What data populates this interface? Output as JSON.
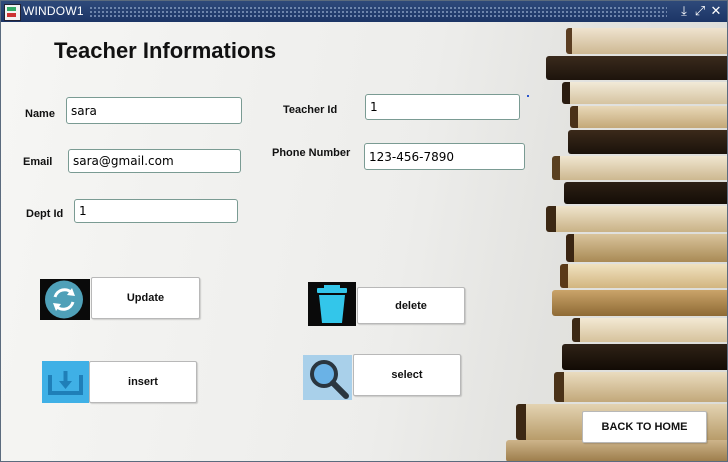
{
  "window": {
    "title": "WINDOW1",
    "controls": {
      "minimize": "⤓",
      "restore": "⤢",
      "close": "✕"
    }
  },
  "form": {
    "heading": "Teacher Informations",
    "fields": {
      "name": {
        "label": "Name",
        "value": "sara"
      },
      "email": {
        "label": "Email",
        "value": "sara@gmail.com"
      },
      "dept_id": {
        "label": "Dept Id",
        "value": "1"
      },
      "teacher_id": {
        "label": "Teacher Id",
        "value": "1"
      },
      "phone": {
        "label": "Phone Number",
        "value": "123-456-7890"
      }
    }
  },
  "actions": {
    "update": "Update",
    "delete": "delete",
    "insert": "insert",
    "select": "select",
    "back": "BACK TO HOME"
  },
  "icons": {
    "update": "refresh-icon",
    "delete": "trash-icon",
    "insert": "tray-download-icon",
    "select": "magnifier-icon"
  },
  "colors": {
    "titlebar": "#1c3566",
    "update_icon_bg": "#4fa0b8",
    "delete_icon_fill": "#33c6ea",
    "insert_icon_bg": "#3fb0e6",
    "select_icon_bg": "#a9d0ea"
  }
}
